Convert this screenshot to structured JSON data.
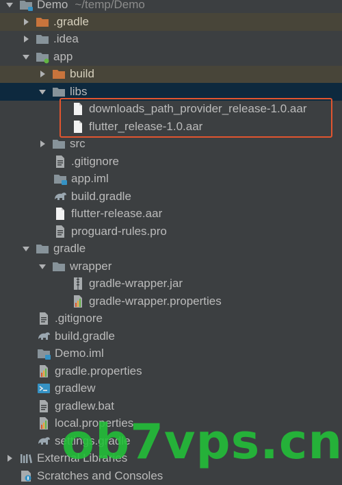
{
  "project_tree": {
    "root": {
      "label": "Demo",
      "path": "~/temp/Demo"
    },
    "items": [
      {
        "label": ".gradle"
      },
      {
        "label": ".idea"
      },
      {
        "label": "app"
      },
      {
        "label": "build"
      },
      {
        "label": "libs"
      },
      {
        "label": "downloads_path_provider_release-1.0.aar"
      },
      {
        "label": "flutter_release-1.0.aar"
      },
      {
        "label": "src"
      },
      {
        "label": ".gitignore"
      },
      {
        "label": "app.iml"
      },
      {
        "label": "build.gradle"
      },
      {
        "label": "flutter-release.aar"
      },
      {
        "label": "proguard-rules.pro"
      },
      {
        "label": "gradle"
      },
      {
        "label": "wrapper"
      },
      {
        "label": "gradle-wrapper.jar"
      },
      {
        "label": "gradle-wrapper.properties"
      },
      {
        "label": ".gitignore"
      },
      {
        "label": "build.gradle"
      },
      {
        "label": "Demo.iml"
      },
      {
        "label": "gradle.properties"
      },
      {
        "label": "gradlew"
      },
      {
        "label": "gradlew.bat"
      },
      {
        "label": "local.properties"
      },
      {
        "label": "settings.gradle"
      },
      {
        "label": "External Libraries"
      },
      {
        "label": "Scratches and Consoles"
      }
    ]
  },
  "watermark": {
    "text": "ob7vps.cn"
  },
  "colors": {
    "background": "#3c3f41",
    "excluded_row": "#484539",
    "selected_row": "#0d293e",
    "highlight_border": "#e2552f",
    "watermark": "#22c138",
    "text": "#bbbbbb"
  }
}
